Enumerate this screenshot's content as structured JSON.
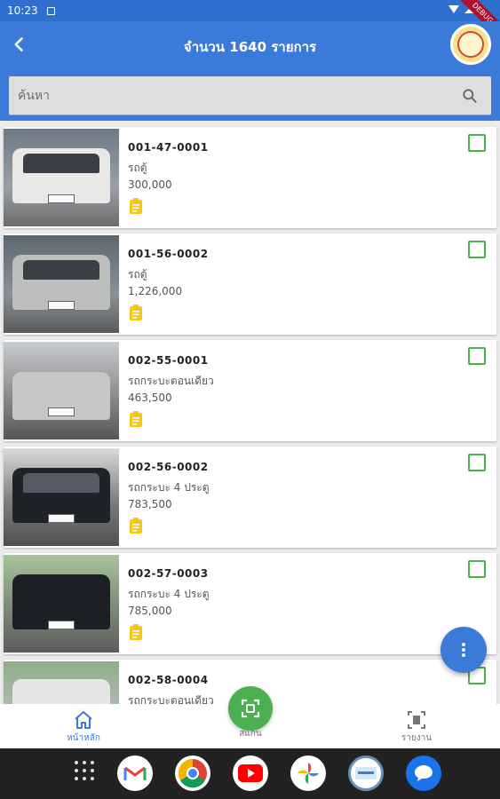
{
  "status_bar": {
    "time": "10:23"
  },
  "debug_banner": "DEBUG",
  "app_bar": {
    "title": "จำนวน 1640 รายการ"
  },
  "search": {
    "placeholder": "ค้นหา",
    "value": ""
  },
  "items": [
    {
      "code": "001-47-0001",
      "type": "รถตู้",
      "price": "300,000",
      "checked": false
    },
    {
      "code": "001-56-0002",
      "type": "รถตู้",
      "price": "1,226,000",
      "checked": false
    },
    {
      "code": "002-55-0001",
      "type": "รถกระบะตอนเดียว",
      "price": "463,500",
      "checked": false
    },
    {
      "code": "002-56-0002",
      "type": "รถกระบะ 4 ประตู",
      "price": "783,500",
      "checked": false
    },
    {
      "code": "002-57-0003",
      "type": "รถกระบะ 4 ประตู",
      "price": "785,000",
      "checked": false
    },
    {
      "code": "002-58-0004",
      "type": "รถกระบะตอนเดียว",
      "price": "",
      "checked": false
    }
  ],
  "bottom_nav": {
    "home": "หน้าหลัก",
    "scan": "สแกน",
    "report": "รายงาน"
  },
  "dock": [
    "Gmail",
    "Chrome",
    "YouTube",
    "Photos",
    "App",
    "Messages"
  ],
  "colors": {
    "primary": "#3b7ad8",
    "accent_green": "#4caf50",
    "doc_yellow": "#f5c518"
  }
}
